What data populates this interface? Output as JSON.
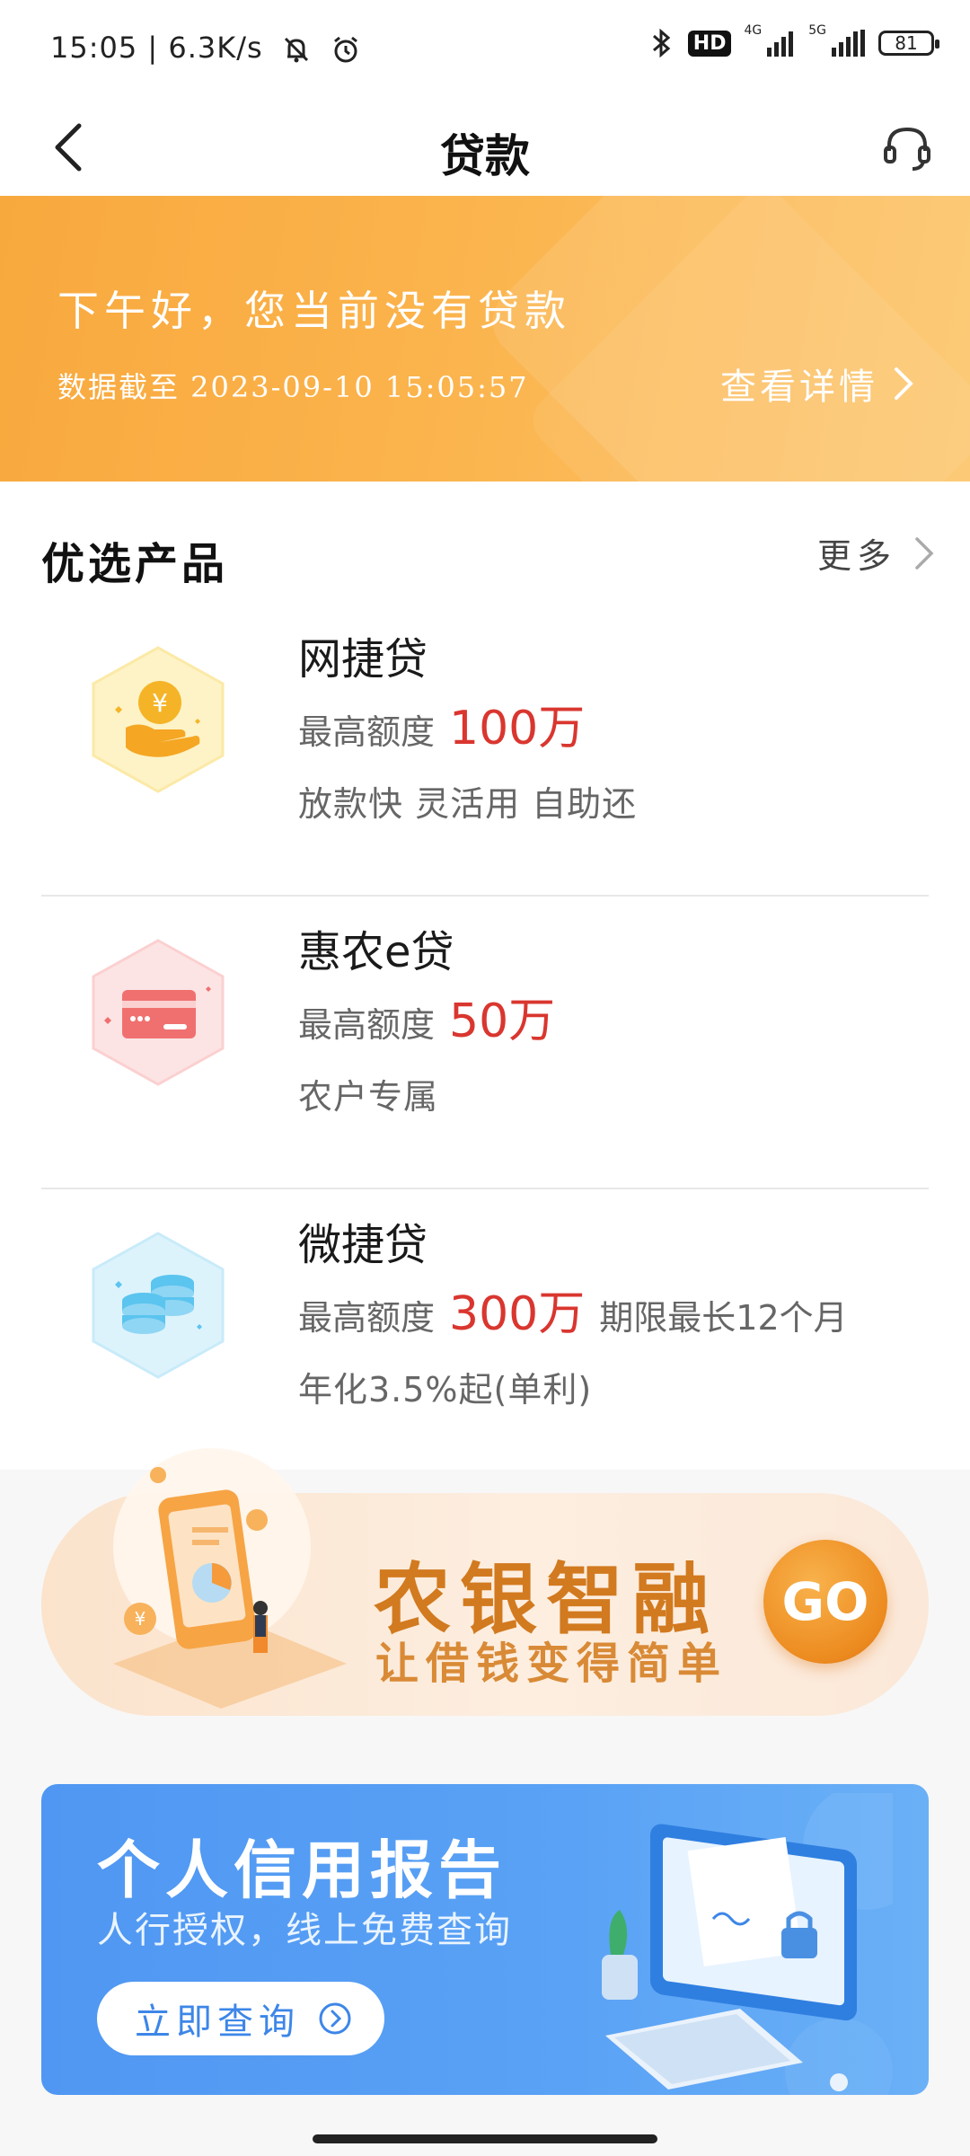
{
  "status_bar": {
    "time": "15:05",
    "separator": "|",
    "speed": "6.3K/s",
    "hd_label": "HD",
    "net1": "4G",
    "net2": "5G",
    "battery": "81"
  },
  "nav": {
    "title": "贷款"
  },
  "banner": {
    "greeting": "下午好，您当前没有贷款",
    "data_time": "数据截至 2023-09-10 15:05:57",
    "view_details": "查看详情"
  },
  "section": {
    "title": "优选产品",
    "more": "更多"
  },
  "products": [
    {
      "name": "网捷贷",
      "limit_label": "最高额度",
      "limit_value": "100万",
      "extra": "",
      "tags": "放款快 灵活用 自助还"
    },
    {
      "name": "惠农e贷",
      "limit_label": "最高额度",
      "limit_value": "50万",
      "extra": "",
      "tags": "农户专属"
    },
    {
      "name": "微捷贷",
      "limit_label": "最高额度",
      "limit_value": "300万",
      "extra": "期限最长12个月",
      "tags": "年化3.5%起(单利)"
    }
  ],
  "zhirong": {
    "title": "农银智融",
    "subtitle": "让借钱变得简单",
    "go": "GO"
  },
  "credit": {
    "title": "个人信用报告",
    "subtitle": "人行授权，线上免费查询",
    "button": "立即查询"
  },
  "colors": {
    "banner_orange": "#f8a93e",
    "amount_red": "#d9362f",
    "credit_blue": "#4f97f2"
  }
}
